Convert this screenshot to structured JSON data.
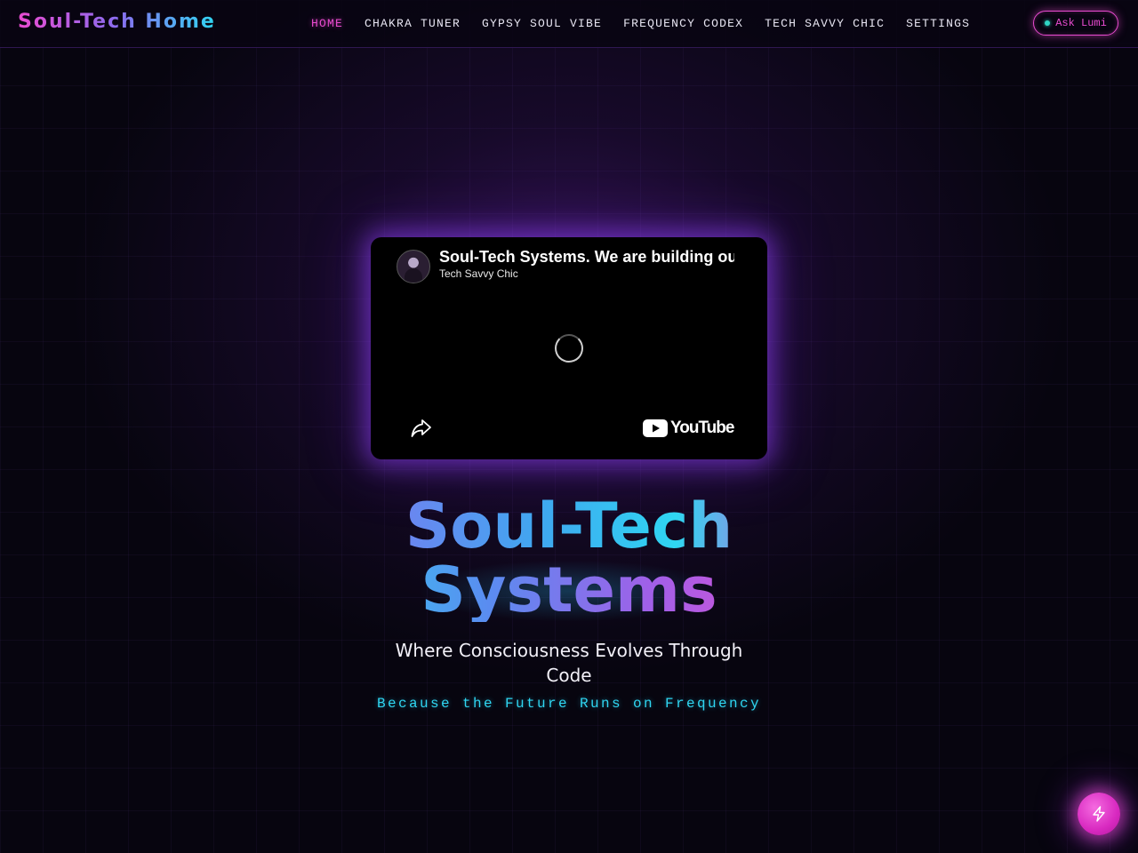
{
  "header": {
    "brand": "Soul-Tech Home",
    "nav": [
      {
        "label": "HOME",
        "active": true
      },
      {
        "label": "CHAKRA TUNER",
        "active": false
      },
      {
        "label": "GYPSY SOUL VIBE",
        "active": false
      },
      {
        "label": "FREQUENCY CODEX",
        "active": false
      },
      {
        "label": "TECH SAVVY CHIC",
        "active": false
      },
      {
        "label": "SETTINGS",
        "active": false
      }
    ],
    "ask_button": {
      "label": "Ask Lumi",
      "status_color": "#2fd6c4"
    }
  },
  "video": {
    "title": "Soul-Tech Systems. We are building our future",
    "channel": "Tech Savvy Chic",
    "logo_text": "YouTube",
    "icons": {
      "share": "share-icon",
      "loading": "spinner-icon",
      "logo": "youtube-logo-icon"
    }
  },
  "hero": {
    "title_line1": "Soul-Tech",
    "title_line2": "Systems",
    "subtitle": "Where Consciousness Evolves Through Code",
    "tagline": "Because the Future Runs on Frequency"
  },
  "fab": {
    "icon": "lightning-icon"
  },
  "colors": {
    "accent_pink": "#e94bd0",
    "accent_cyan": "#2fd6f2",
    "accent_purple": "#8b6cf0",
    "background": "#07050f"
  }
}
